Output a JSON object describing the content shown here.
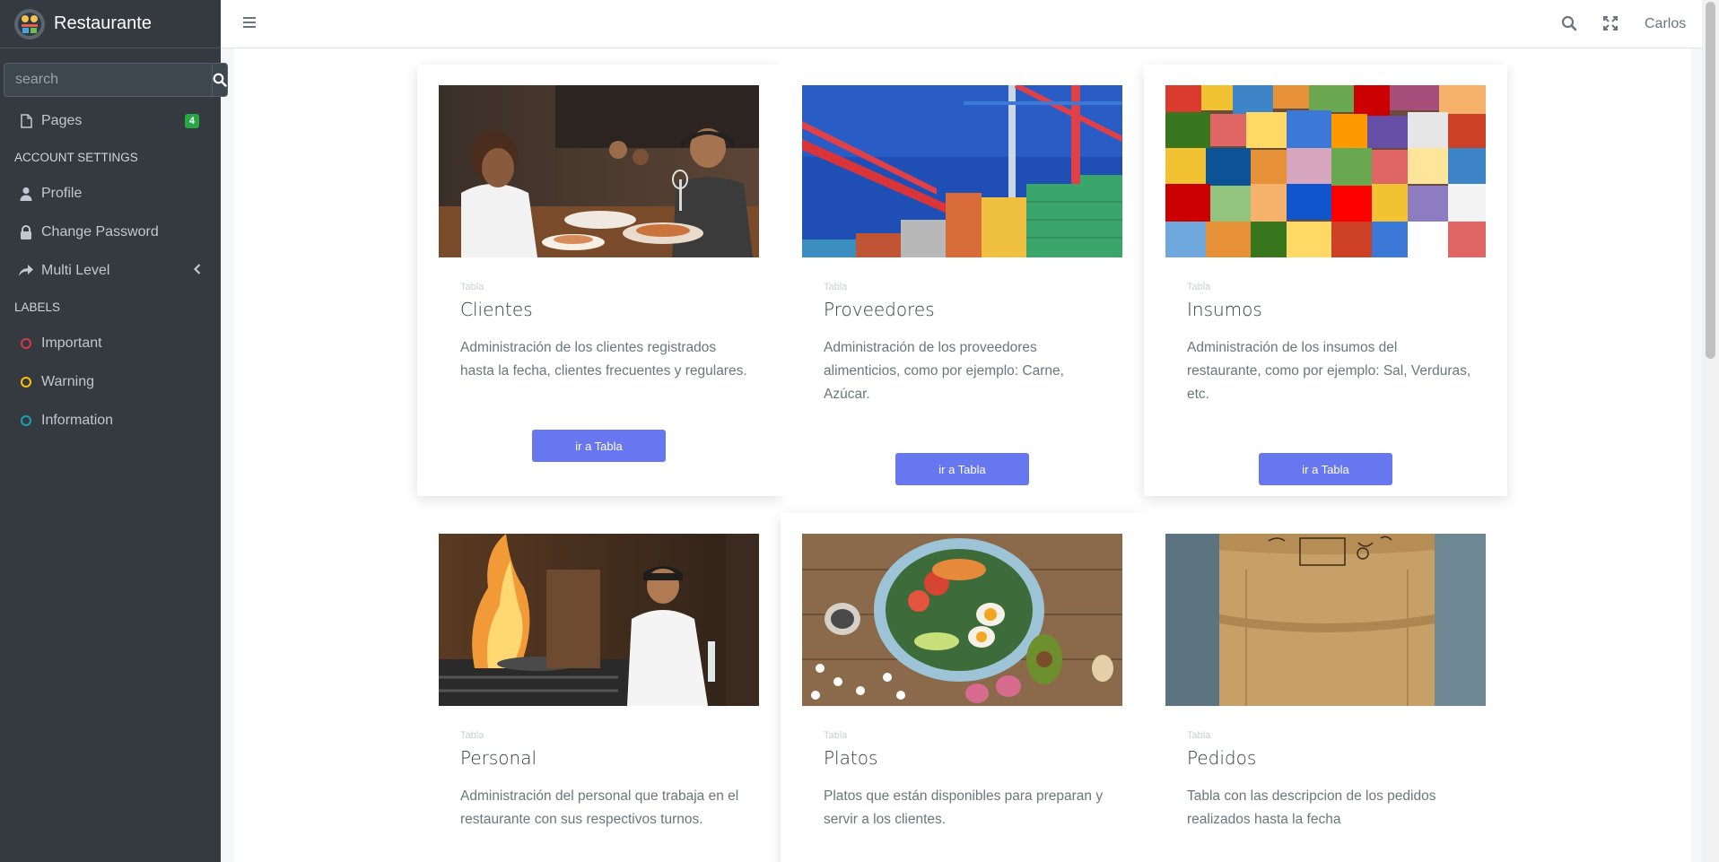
{
  "brand": {
    "name": "Restaurante"
  },
  "sidebar": {
    "search_placeholder": "search",
    "pages": {
      "label": "Pages",
      "badge": "4"
    },
    "account_header": "ACCOUNT SETTINGS",
    "account_items": [
      {
        "label": "Profile",
        "icon": "user-icon"
      },
      {
        "label": "Change Password",
        "icon": "lock-icon"
      },
      {
        "label": "Multi Level",
        "icon": "share-icon"
      }
    ],
    "labels_header": "LABELS",
    "labels": [
      {
        "label": "Important",
        "color": "#dc3545"
      },
      {
        "label": "Warning",
        "color": "#ffc107"
      },
      {
        "label": "Information",
        "color": "#17a2b8"
      }
    ]
  },
  "navbar": {
    "user": "Carlos"
  },
  "cards": [
    {
      "eyebrow": "Tabla",
      "title": "Clientes",
      "description": "Administración de los clientes registrados hasta la fecha, clientes frecuentes y regulares.",
      "button": "ir a Tabla"
    },
    {
      "eyebrow": "Tabla",
      "title": "Proveedores",
      "description": "Administración de los proveedores alimenticios, como por ejemplo: Carne, Azúcar.",
      "button": "ir a Tabla"
    },
    {
      "eyebrow": "Tabla",
      "title": "Insumos",
      "description": "Administración de los insumos del restaurante, como por ejemplo: Sal, Verduras, etc.",
      "button": "ir a Tabla"
    },
    {
      "eyebrow": "Tabla",
      "title": "Personal",
      "description": "Administración del personal que trabaja en el restaurante con sus respectivos turnos."
    },
    {
      "eyebrow": "Tabla",
      "title": "Platos",
      "description": "Platos que están disponibles para preparan y servir a los clientes."
    },
    {
      "eyebrow": "Tabla",
      "title": "Pedidos",
      "description": "Tabla con las descripcion de los pedidos realizados hasta la fecha"
    }
  ]
}
